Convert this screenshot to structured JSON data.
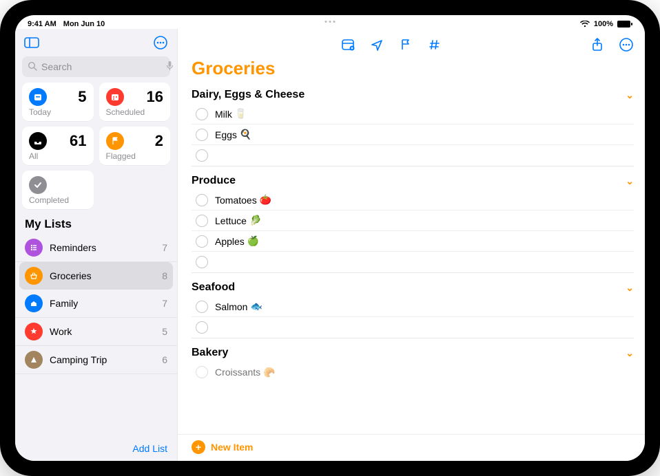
{
  "status": {
    "time": "9:41 AM",
    "date": "Mon Jun 10",
    "battery": "100%"
  },
  "search": {
    "placeholder": "Search"
  },
  "cards": {
    "today": {
      "label": "Today",
      "count": "5"
    },
    "scheduled": {
      "label": "Scheduled",
      "count": "16"
    },
    "all": {
      "label": "All",
      "count": "61"
    },
    "flagged": {
      "label": "Flagged",
      "count": "2"
    },
    "completed": {
      "label": "Completed"
    }
  },
  "mylists_header": "My Lists",
  "lists": {
    "reminders": {
      "name": "Reminders",
      "count": "7"
    },
    "groceries": {
      "name": "Groceries",
      "count": "8"
    },
    "family": {
      "name": "Family",
      "count": "7"
    },
    "work": {
      "name": "Work",
      "count": "5"
    },
    "camping": {
      "name": "Camping Trip",
      "count": "6"
    }
  },
  "add_list": "Add List",
  "main": {
    "title": "Groceries",
    "new_item": "New Item",
    "sections": {
      "dairy": {
        "title": "Dairy, Eggs & Cheese",
        "i0": "Milk",
        "e0": "🥛",
        "i1": "Eggs",
        "e1": "🍳"
      },
      "produce": {
        "title": "Produce",
        "i0": "Tomatoes",
        "e0": "🍅",
        "i1": "Lettuce",
        "e1": "🥬",
        "i2": "Apples",
        "e2": "🍏"
      },
      "seafood": {
        "title": "Seafood",
        "i0": "Salmon",
        "e0": "🐟"
      },
      "bakery": {
        "title": "Bakery",
        "i0": "Croissants",
        "e0": "🥐"
      }
    }
  }
}
